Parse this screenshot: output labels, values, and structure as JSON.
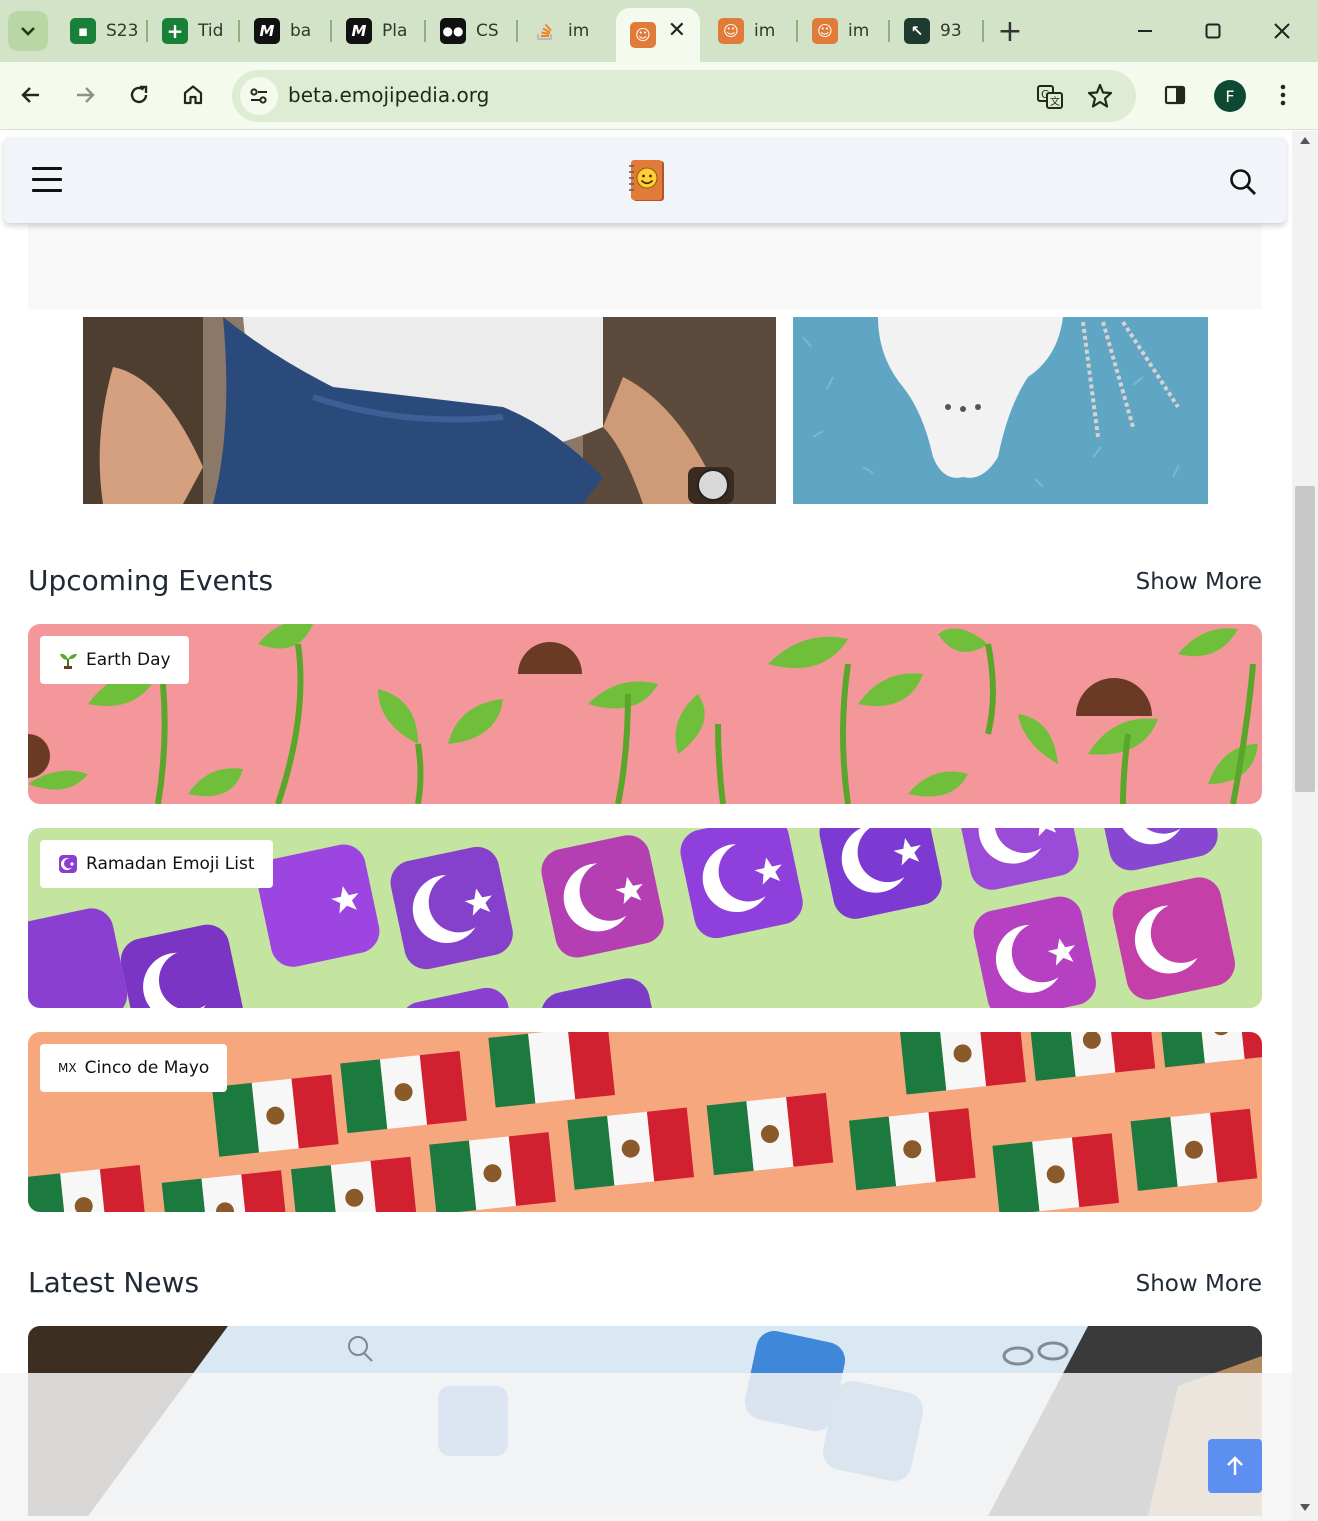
{
  "browser": {
    "tabs": [
      {
        "title": "S23",
        "favicon": "google-sheets-icon",
        "color": "#188038"
      },
      {
        "title": "Tid",
        "favicon": "google-sheets-plus-icon",
        "color": "#188038"
      },
      {
        "title": "ba",
        "favicon": "m-logo-icon",
        "color": "#111111"
      },
      {
        "title": "Pla",
        "favicon": "m-logo-icon",
        "color": "#111111"
      },
      {
        "title": "CS",
        "favicon": "medium-icon",
        "color": "#111111"
      },
      {
        "title": "im",
        "favicon": "stackoverflow-icon",
        "color": "#f48024"
      },
      {
        "title": "",
        "favicon": "emojipedia-icon",
        "color": "#e07b39",
        "active": true
      },
      {
        "title": "im",
        "favicon": "emojipedia-icon",
        "color": "#e07b39"
      },
      {
        "title": "im",
        "favicon": "emojipedia-icon",
        "color": "#e07b39"
      },
      {
        "title": "93",
        "favicon": "cursor-app-icon",
        "color": "#1f3b2f"
      }
    ],
    "url": "beta.emojipedia.org",
    "profile_initial": "F",
    "accent": "#d3e3c7"
  },
  "site": {
    "logo": "emojipedia-logo-icon"
  },
  "upcoming": {
    "title": "Upcoming Events",
    "show_more": "Show More",
    "events": [
      {
        "label": "Earth Day",
        "icon": "seedling-icon",
        "bg": "#f4979b"
      },
      {
        "label": "Ramadan Emoji List",
        "icon": "star-crescent-icon",
        "bg": "#c4e59f"
      },
      {
        "label": "Cinco de Mayo",
        "icon_text": "MX",
        "bg": "#f6a77e"
      }
    ]
  },
  "news": {
    "title": "Latest News",
    "show_more": "Show More"
  }
}
